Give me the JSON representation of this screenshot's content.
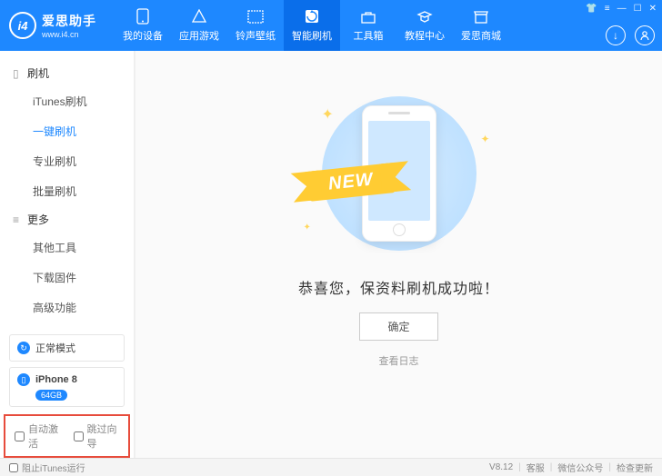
{
  "header": {
    "logo_badge": "i4",
    "app_name": "爱思助手",
    "app_url": "www.i4.cn",
    "tabs": [
      {
        "label": "我的设备"
      },
      {
        "label": "应用游戏"
      },
      {
        "label": "铃声壁纸"
      },
      {
        "label": "智能刷机"
      },
      {
        "label": "工具箱"
      },
      {
        "label": "教程中心"
      },
      {
        "label": "爱思商城"
      }
    ]
  },
  "sidebar": {
    "group1": "刷机",
    "items1": [
      {
        "label": "iTunes刷机"
      },
      {
        "label": "一键刷机"
      },
      {
        "label": "专业刷机"
      },
      {
        "label": "批量刷机"
      }
    ],
    "group2": "更多",
    "items2": [
      {
        "label": "其他工具"
      },
      {
        "label": "下载固件"
      },
      {
        "label": "高级功能"
      }
    ],
    "mode": "正常模式",
    "device": "iPhone 8",
    "storage": "64GB",
    "auto_activate": "自动激活",
    "skip_guide": "跳过向导"
  },
  "main": {
    "ribbon": "NEW",
    "message": "恭喜您，保资料刷机成功啦！",
    "ok": "确定",
    "log": "查看日志"
  },
  "footer": {
    "block_itunes": "阻止iTunes运行",
    "version": "V8.12",
    "support": "客服",
    "wechat": "微信公众号",
    "update": "检查更新"
  }
}
